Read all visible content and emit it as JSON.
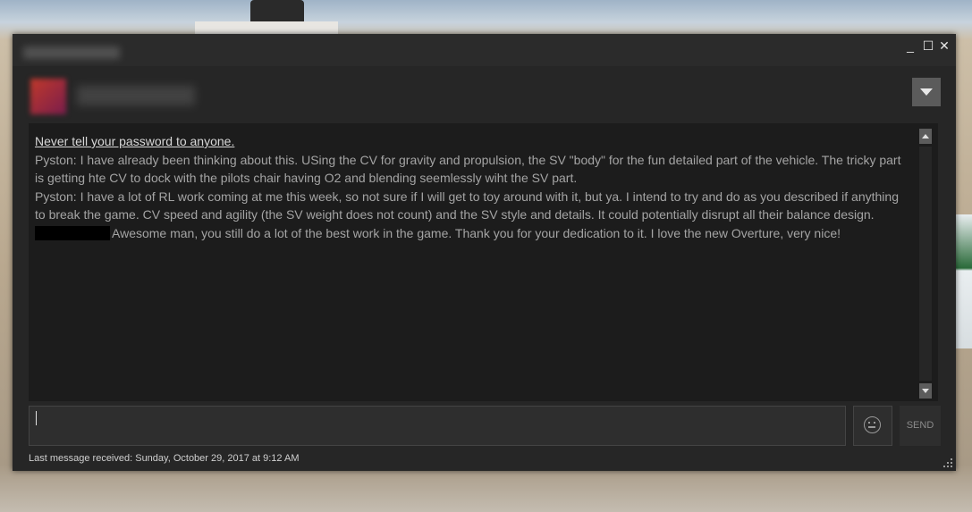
{
  "window": {
    "controls": {
      "minimize": "_",
      "maximize": "☐",
      "close": "✕"
    }
  },
  "chat": {
    "warning": "Never tell your password to anyone.",
    "messages": [
      {
        "text": "Pyston: I have already been thinking about this. USing the CV for gravity and propulsion, the SV \"body\" for the fun detailed part of the vehicle. The tricky part is getting hte CV to dock with the pilots chair having O2 and blending seemlessly wiht the SV part."
      },
      {
        "text": "Pyston: I have a lot of RL work coming at me this week, so not sure if I will get to toy around with it, but ya. I intend to try and do as you described if anything to break the game. CV speed and agility (the SV weight does not count) and the SV style and details. It could potentially disrupt all their balance design."
      },
      {
        "text": "Awesome man, you still do a lot of the best work in the game. Thank you for your dedication to it. I love the new Overture, very nice!"
      }
    ]
  },
  "composer": {
    "input_value": "",
    "send_label": "SEND",
    "emoji_icon": "smiley-icon"
  },
  "status": {
    "text": "Last message received: Sunday, October 29, 2017 at 9:12 AM"
  }
}
